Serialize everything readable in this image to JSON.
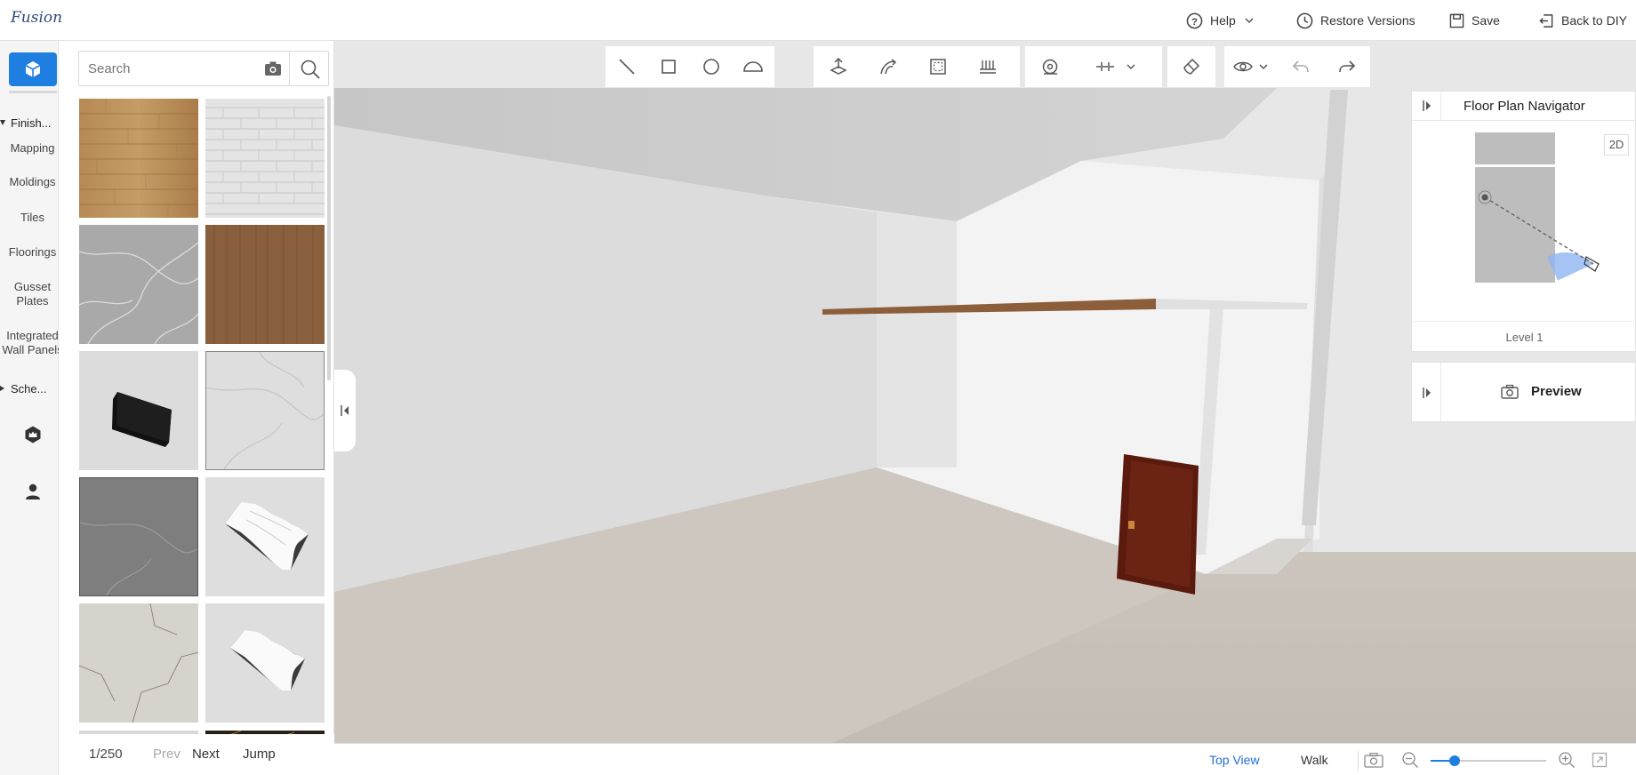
{
  "app": {
    "logo_text": "Fusion"
  },
  "topbar": {
    "help": "Help",
    "restore_versions": "Restore Versions",
    "save": "Save",
    "back_to_diy": "Back to DIY"
  },
  "leftnav": {
    "group_finishes": "Finish...",
    "items": [
      "Mapping",
      "Moldings",
      "Tiles",
      "Floorings",
      "Gusset Plates",
      "Integrated Wall Panels"
    ],
    "group_schemes": "Sche..."
  },
  "catalog": {
    "search_placeholder": "Search",
    "tiles": [
      {
        "kind": "wood-planks"
      },
      {
        "kind": "white-brick"
      },
      {
        "kind": "grey-marble"
      },
      {
        "kind": "walnut-wood"
      },
      {
        "kind": "black-panel"
      },
      {
        "kind": "light-marble"
      },
      {
        "kind": "dark-grey-marble"
      },
      {
        "kind": "crown-molding"
      },
      {
        "kind": "cracked-marble"
      },
      {
        "kind": "crown-molding-small"
      }
    ],
    "pager": {
      "page": "1/250",
      "prev": "Prev",
      "next": "Next",
      "jump": "Jump"
    }
  },
  "navigator": {
    "title": "Floor Plan Navigator",
    "mode_2d": "2D",
    "level": "Level 1"
  },
  "preview": {
    "label": "Preview"
  },
  "bottombar": {
    "top_view": "Top View",
    "walk": "Walk",
    "zoom_level": 0.2
  },
  "colors": {
    "accent": "#1f7fe0",
    "wood": "#b3864f",
    "door": "#5a1a0e"
  }
}
